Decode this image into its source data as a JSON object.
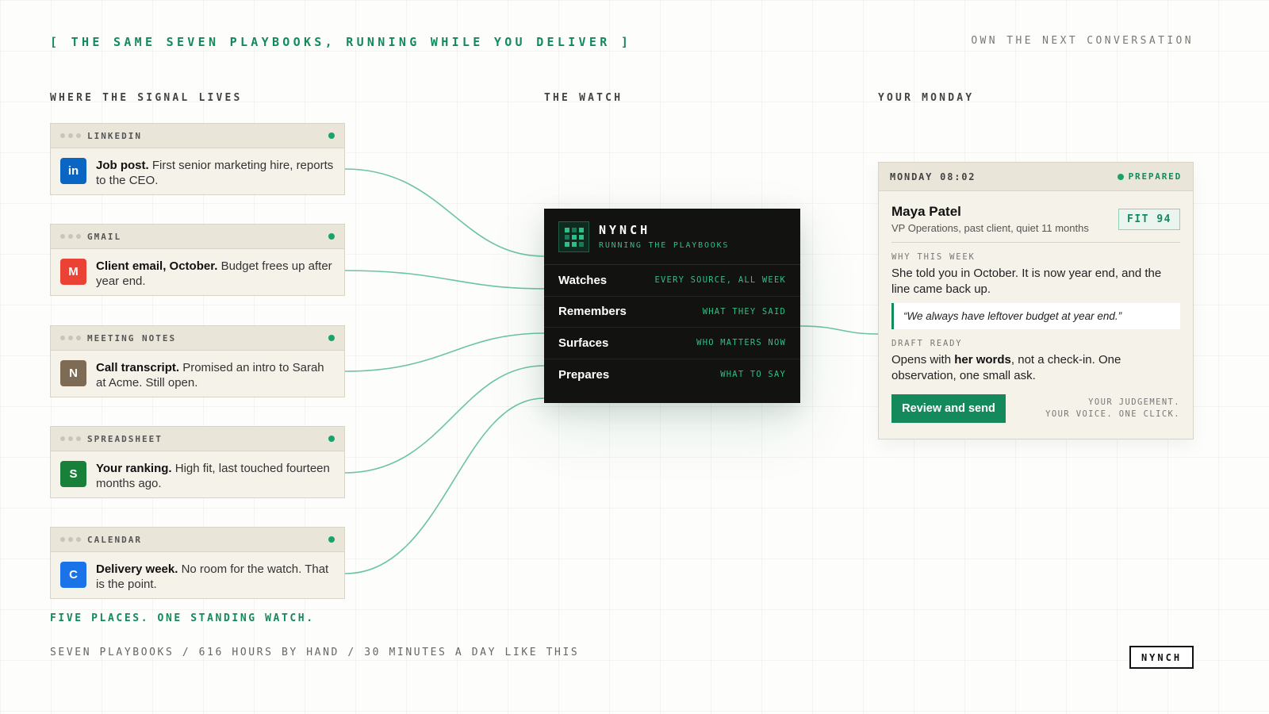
{
  "header": {
    "tagline": "[ THE SAME SEVEN PLAYBOOKS, RUNNING WHILE YOU DELIVER ]",
    "right_note": "OWN THE NEXT CONVERSATION"
  },
  "columns": {
    "signal": "WHERE THE SIGNAL LIVES",
    "watch": "THE WATCH",
    "monday": "YOUR MONDAY"
  },
  "sources": [
    {
      "name": "LINKEDIN",
      "icon_letter": "in",
      "icon": "linkedin-icon",
      "color": "#0a66c2",
      "title": "Job post.",
      "text": "First senior marketing hire, reports to the CEO."
    },
    {
      "name": "GMAIL",
      "icon_letter": "M",
      "icon": "gmail-icon",
      "color": "#ea4335",
      "title": "Client email, October.",
      "text": "Budget frees up after year end."
    },
    {
      "name": "MEETING NOTES",
      "icon_letter": "N",
      "icon": "notes-icon",
      "color": "#7d6b56",
      "title": "Call transcript.",
      "text": "Promised an intro to Sarah at Acme. Still open."
    },
    {
      "name": "SPREADSHEET",
      "icon_letter": "S",
      "icon": "spreadsheet-icon",
      "color": "#188038",
      "title": "Your ranking.",
      "text": "High fit, last touched fourteen months ago."
    },
    {
      "name": "CALENDAR",
      "icon_letter": "C",
      "icon": "calendar-icon",
      "color": "#1a73e8",
      "title": "Delivery week.",
      "text": "No room for the watch. That is the point."
    }
  ],
  "engine": {
    "title": "NYNCH",
    "subtitle": "RUNNING THE PLAYBOOKS",
    "rows": [
      {
        "label": "Watches",
        "note": "EVERY SOURCE, ALL WEEK"
      },
      {
        "label": "Remembers",
        "note": "WHAT THEY SAID"
      },
      {
        "label": "Surfaces",
        "note": "WHO MATTERS NOW"
      },
      {
        "label": "Prepares",
        "note": "WHAT TO SAY"
      }
    ]
  },
  "monday": {
    "time": "MONDAY 08:02",
    "status": "PREPARED",
    "person_name": "Maya Patel",
    "person_role": "VP Operations, past client, quiet 11 months",
    "fit": "FIT 94",
    "why_label": "WHY THIS WEEK",
    "why_text": "She told you in October. It is now year end, and the line came back up.",
    "quote": "“We always have leftover budget at year end.”",
    "draft_label": "DRAFT READY",
    "draft_pre": "Opens with ",
    "draft_bold": "her words",
    "draft_post": ", not a check-in. One observation, one small ask.",
    "button": "Review and send",
    "judgement_line1": "YOUR JUDGEMENT.",
    "judgement_line2": "YOUR VOICE. ONE CLICK."
  },
  "footer": {
    "tagline": "FIVE PLACES. ONE STANDING WATCH.",
    "stats": "SEVEN PLAYBOOKS / 616 HOURS BY HAND / 30 MINUTES A DAY LIKE THIS",
    "logo": "NYNCH"
  },
  "colors": {
    "accent": "#148a5c",
    "connector": "#6cc4a1",
    "engine_bg": "#121211",
    "card_bg": "#f5f2ea"
  }
}
